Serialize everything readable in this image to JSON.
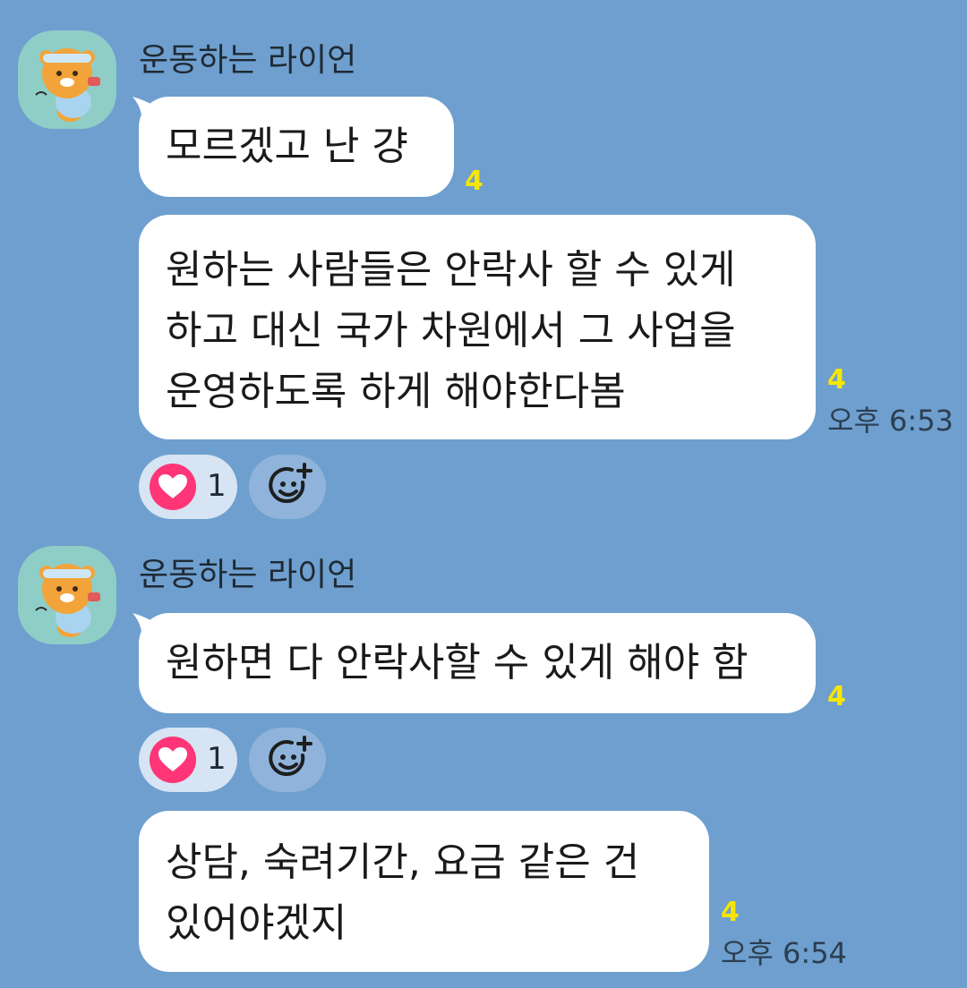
{
  "messages": [
    {
      "sender": "운동하는 라이언",
      "bubbles": [
        {
          "lines": [
            "모르겠고 난 걍"
          ],
          "unread": "4"
        },
        {
          "lines": [
            "원하는 사람들은 안락사 할 수 있게",
            "하고 대신 국가 차원에서 그 사업을",
            "운영하도록 하게 해야한다봄"
          ],
          "unread": "4",
          "time": "오후 6:53"
        }
      ],
      "reaction": {
        "icon": "heart-icon",
        "count": "1"
      }
    },
    {
      "sender": "운동하는 라이언",
      "bubbles": [
        {
          "lines": [
            "원하면 다 안락사할 수 있게 해야 함"
          ],
          "unread": "4"
        }
      ],
      "reaction": {
        "icon": "heart-icon",
        "count": "1"
      }
    },
    {
      "bubbles": [
        {
          "lines": [
            "상담, 숙려기간, 요금 같은 건",
            "있어야겠지"
          ],
          "unread": "4",
          "time": "오후 6:54"
        }
      ]
    }
  ],
  "colors": {
    "background": "#6e9fcf",
    "bubble": "#ffffff",
    "unread": "#f7e600",
    "reaction_heart": "#ff3577",
    "avatar_bg": "#8fcdc7"
  }
}
